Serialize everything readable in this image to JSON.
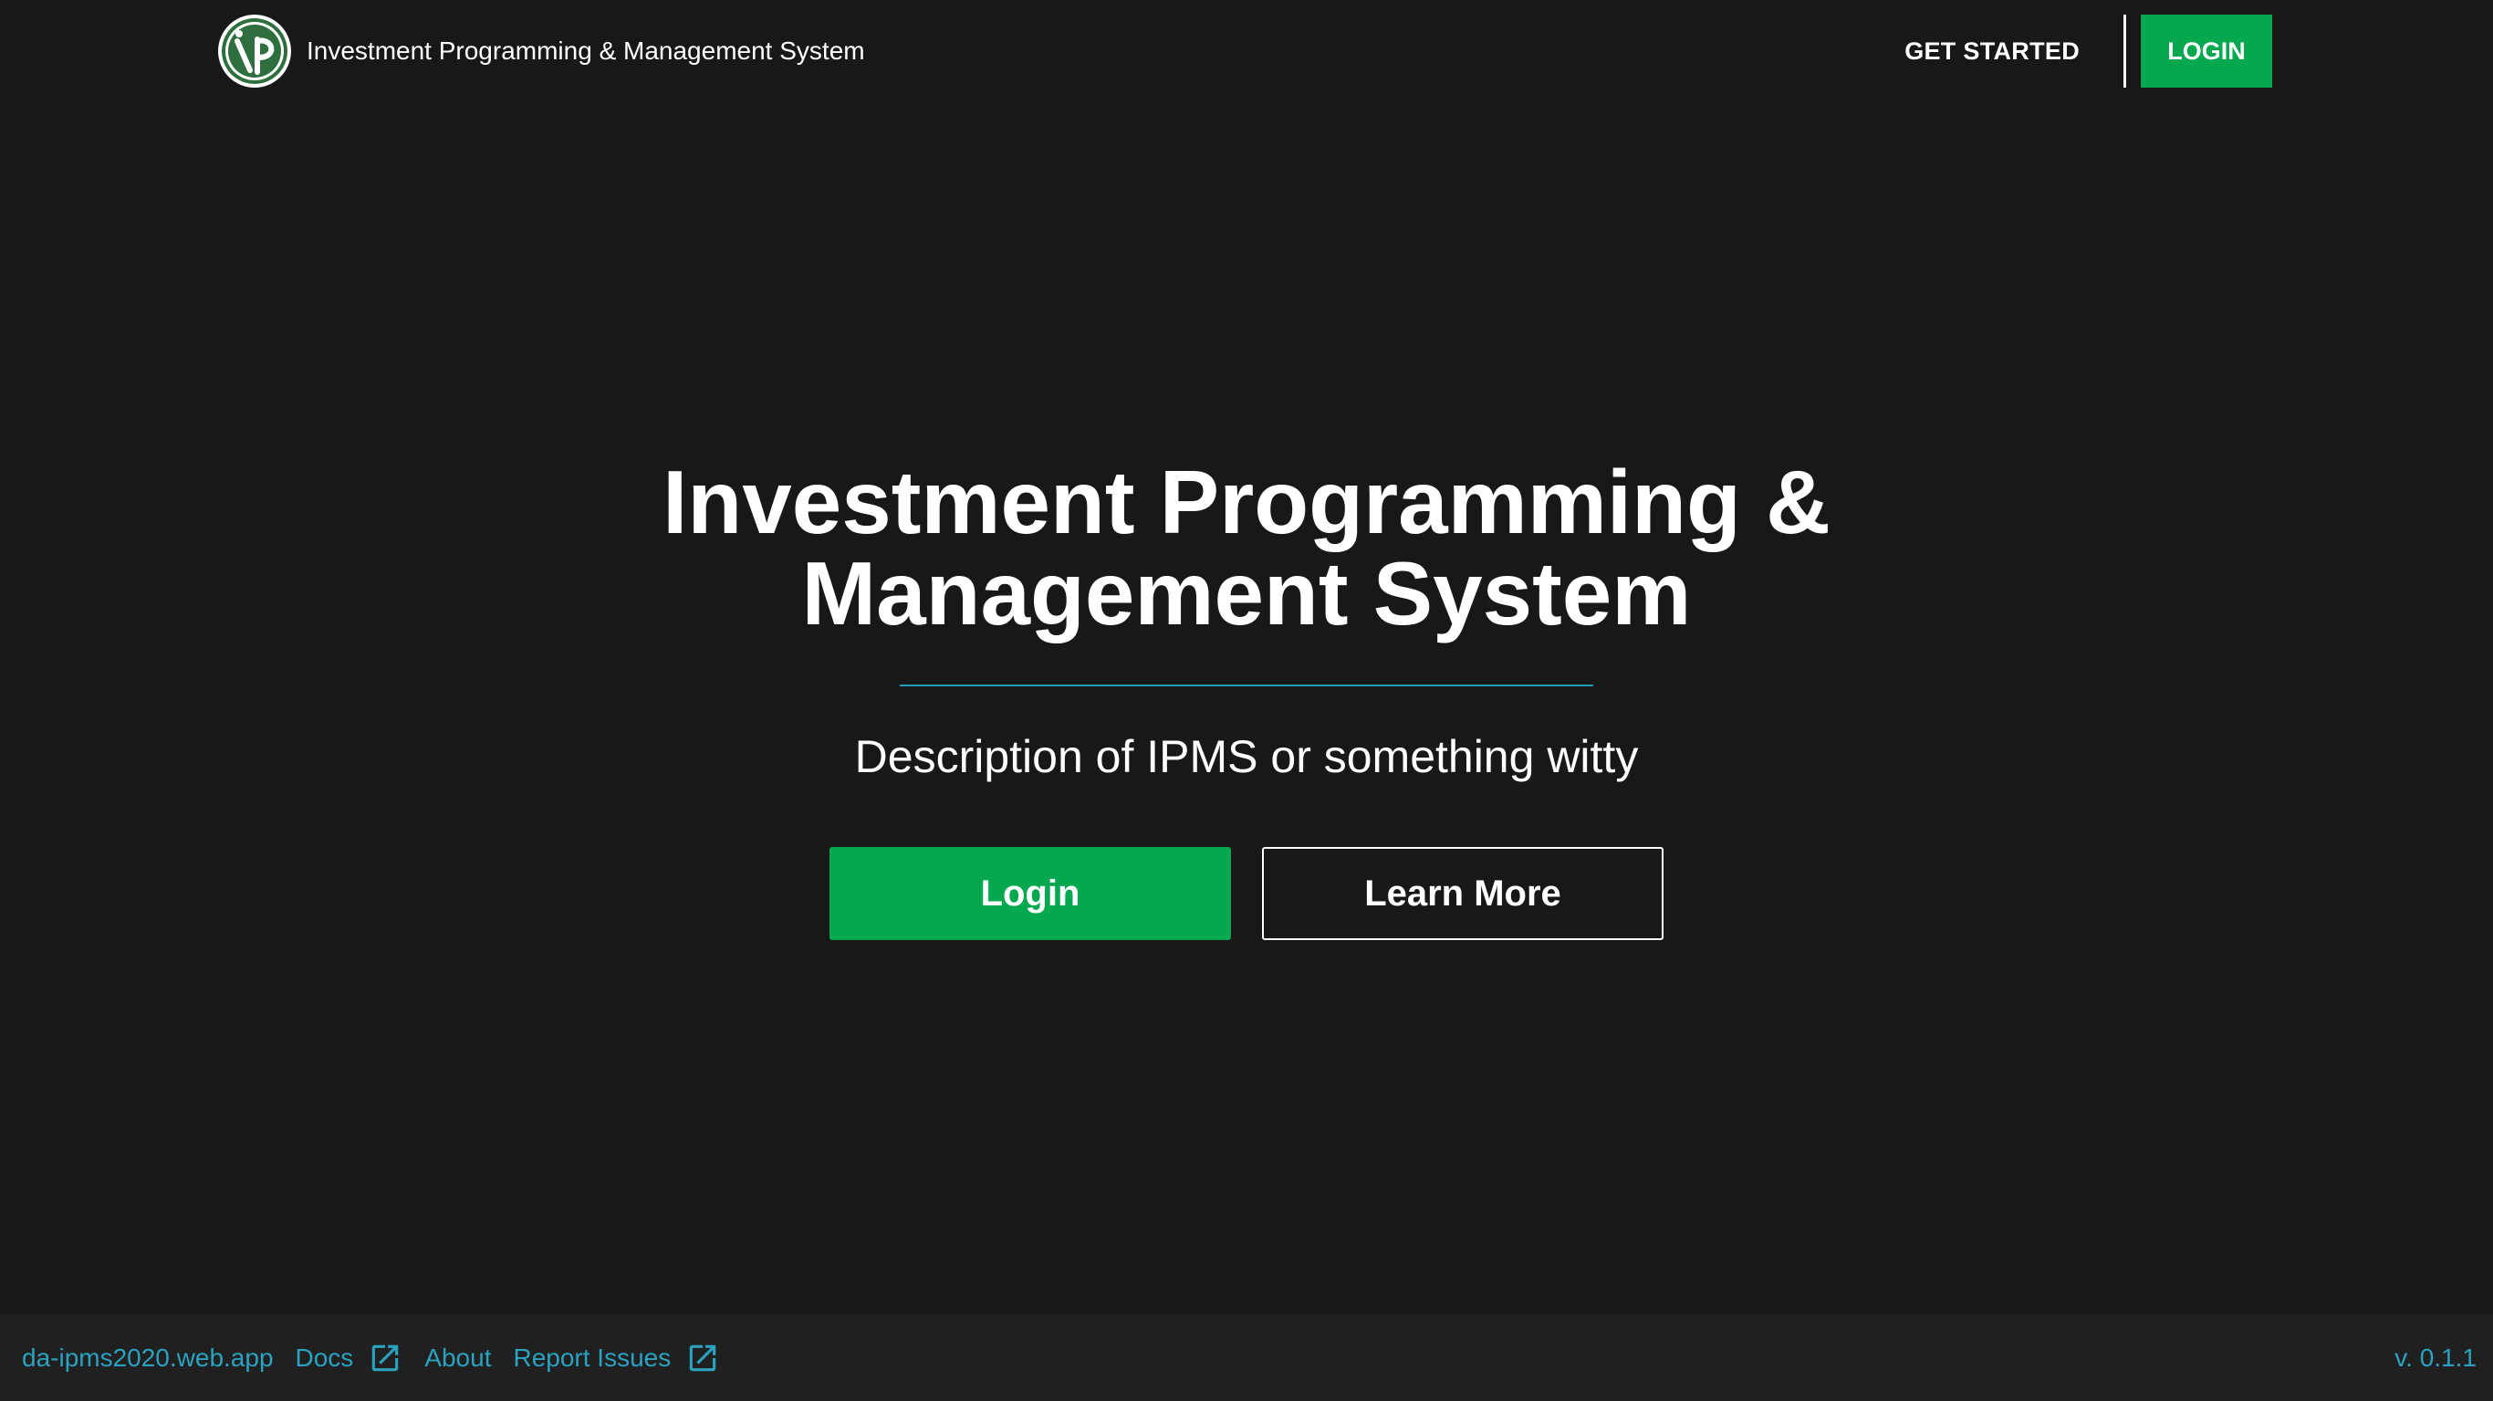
{
  "header": {
    "brand_title": "Investment Programming & Management System",
    "logo_icon": "ipms-logo-icon",
    "nav": {
      "get_started": "GET STARTED",
      "login": "LOGIN"
    }
  },
  "hero": {
    "title_line1": "Investment Programming &",
    "title_line2": "Management System",
    "description": "Description of IPMS or something witty",
    "login_button": "Login",
    "learn_more_button": "Learn More"
  },
  "footer": {
    "links": [
      {
        "label": "da-ipms2020.web.app",
        "icon": ""
      },
      {
        "label": "Docs",
        "icon": "external-link-icon"
      },
      {
        "label": "About",
        "icon": ""
      },
      {
        "label": "Report Issues",
        "icon": "external-link-icon"
      }
    ],
    "version": "v. 0.1.1"
  },
  "colors": {
    "background": "#181818",
    "footer_background": "#202020",
    "accent_green": "#04a84f",
    "link_blue": "#2aa2c0",
    "divider_blue": "#1e9bb5",
    "text": "#ffffff"
  }
}
